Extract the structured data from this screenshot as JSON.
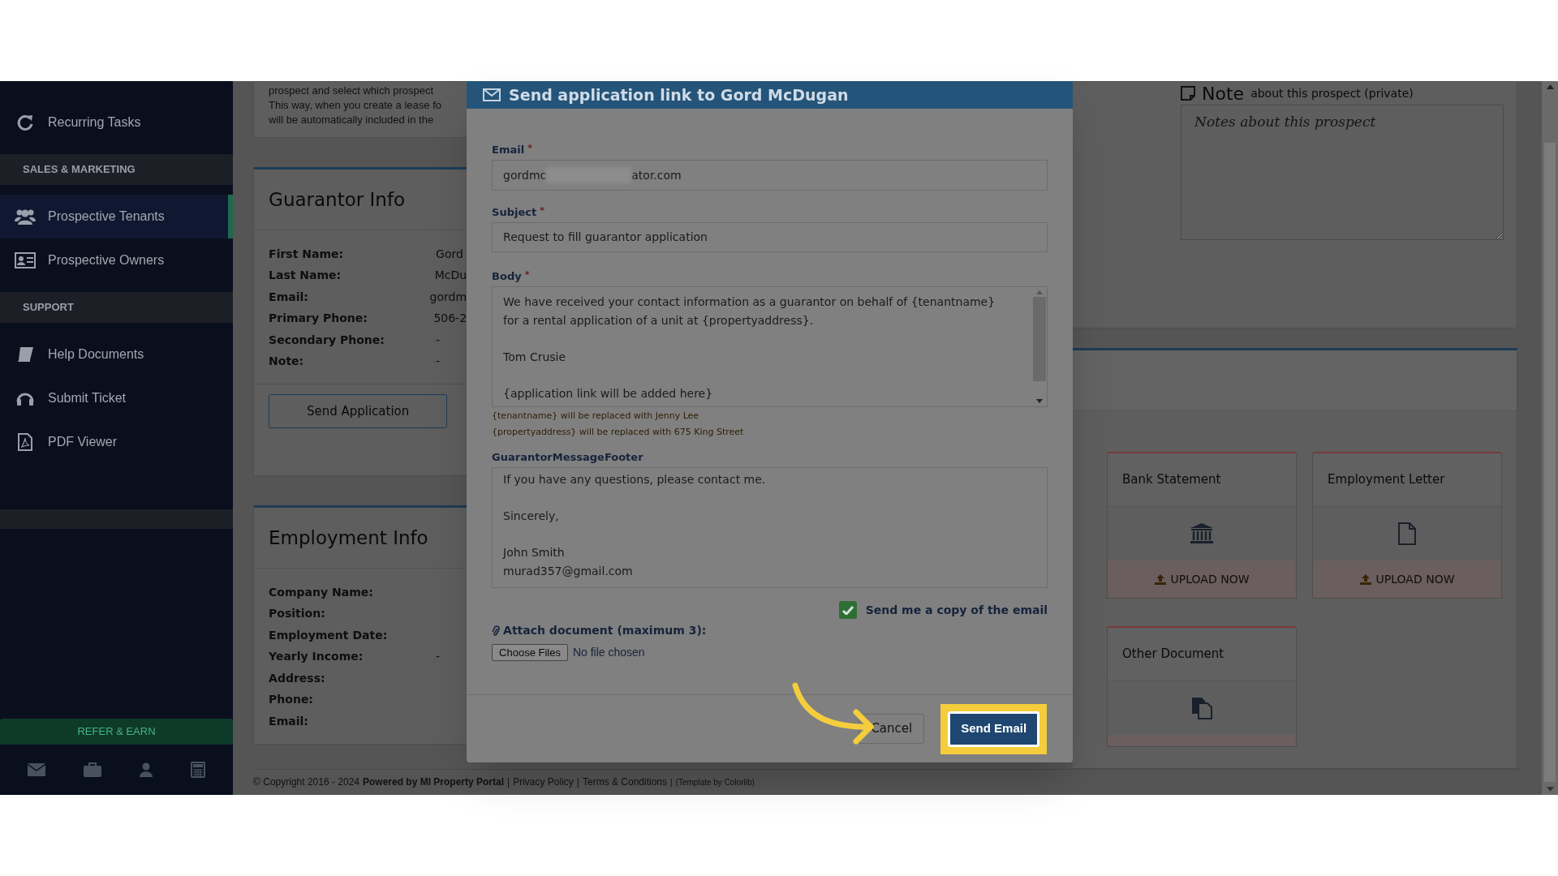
{
  "sidebar": {
    "items": [
      {
        "kind": "item",
        "label": "Recurring Tasks",
        "selected": false
      },
      {
        "kind": "section",
        "label": "SALES & MARKETING"
      },
      {
        "kind": "item",
        "label": "Prospective Tenants",
        "selected": true
      },
      {
        "kind": "item",
        "label": "Prospective Owners",
        "selected": false
      },
      {
        "kind": "section",
        "label": "SUPPORT"
      },
      {
        "kind": "item",
        "label": "Help Documents",
        "selected": false
      },
      {
        "kind": "item",
        "label": "Submit Ticket",
        "selected": false
      },
      {
        "kind": "item",
        "label": "PDF Viewer",
        "selected": false
      }
    ],
    "refer_button": "REFER & EARN"
  },
  "intro_lines": [
    "prospect and select which prospect",
    "This way, when you create a lease fo",
    "will be automatically included in the"
  ],
  "guarantor_info": {
    "title": "Guarantor Info",
    "rows": [
      {
        "label": "First Name:",
        "value": "Gord"
      },
      {
        "label": "Last Name:",
        "value": "McDu"
      },
      {
        "label": "Email:",
        "value": "gordm"
      },
      {
        "label": "Primary Phone:",
        "value": "506-2"
      },
      {
        "label": "Secondary Phone:",
        "value": "-"
      },
      {
        "label": "Note:",
        "value": "-"
      }
    ],
    "button": "Send Application"
  },
  "employment_info": {
    "title": "Employment Info",
    "rows": [
      {
        "label": "Company Name:"
      },
      {
        "label": "Position:"
      },
      {
        "label": "Employment Date:"
      },
      {
        "label": "Yearly Income:",
        "value": "-"
      },
      {
        "label": "Address:"
      },
      {
        "label": "Phone:"
      },
      {
        "label": "Email:"
      }
    ]
  },
  "note_panel": {
    "title": "Note",
    "subtitle": "about this prospect (private)",
    "placeholder": "Notes about this prospect"
  },
  "documents": [
    {
      "title": "Bank Statement",
      "upload": "UPLOAD NOW"
    },
    {
      "title": "Employment Letter",
      "upload": "UPLOAD NOW"
    },
    {
      "title": "Other Document"
    }
  ],
  "modal": {
    "title": "Send application link to Gord McDugan",
    "email": {
      "label": "Email",
      "required": "*",
      "value_start": "gordmc",
      "value_end": "ator.com"
    },
    "subject": {
      "label": "Subject",
      "required": "*",
      "value": "Request to fill guarantor application"
    },
    "body": {
      "label": "Body",
      "required": "*",
      "value": "We have received your contact information as a guarantor on behalf of {tenantname}\nfor a rental application of a unit at {propertyaddress}.\n\nTom Crusie\n\n{application link will be added here}"
    },
    "hints": [
      "{tenantname} will be replaced with Jenny Lee",
      "{propertyaddress} will be replaced with 675 King Street"
    ],
    "footer": {
      "label": "GuarantorMessageFooter",
      "value": "If you have any questions, please contact me.\n\nSincerely,\n\nJohn Smith\nmurad357@gmail.com"
    },
    "copy_checkbox": {
      "label": "Send me a copy of the email",
      "checked": true
    },
    "attach": {
      "label": "Attach document (maximum 3):",
      "button": "Choose Files",
      "status": "No file chosen"
    },
    "cancel": "Cancel",
    "send": "Send Email"
  },
  "footer": [
    {
      "kind": "copyright",
      "text": "© Copyright 2016 - 2024"
    },
    {
      "kind": "powered",
      "text": "Powered by MI Property Portal"
    },
    {
      "kind": "separator",
      "text": "|"
    },
    {
      "kind": "link",
      "text": "Privacy Policy"
    },
    {
      "kind": "separator",
      "text": "|"
    },
    {
      "kind": "link",
      "text": "Terms & Conditions"
    },
    {
      "kind": "small_separator",
      "text": "|"
    },
    {
      "kind": "credit",
      "text": "(Template by Colorlib)"
    }
  ]
}
